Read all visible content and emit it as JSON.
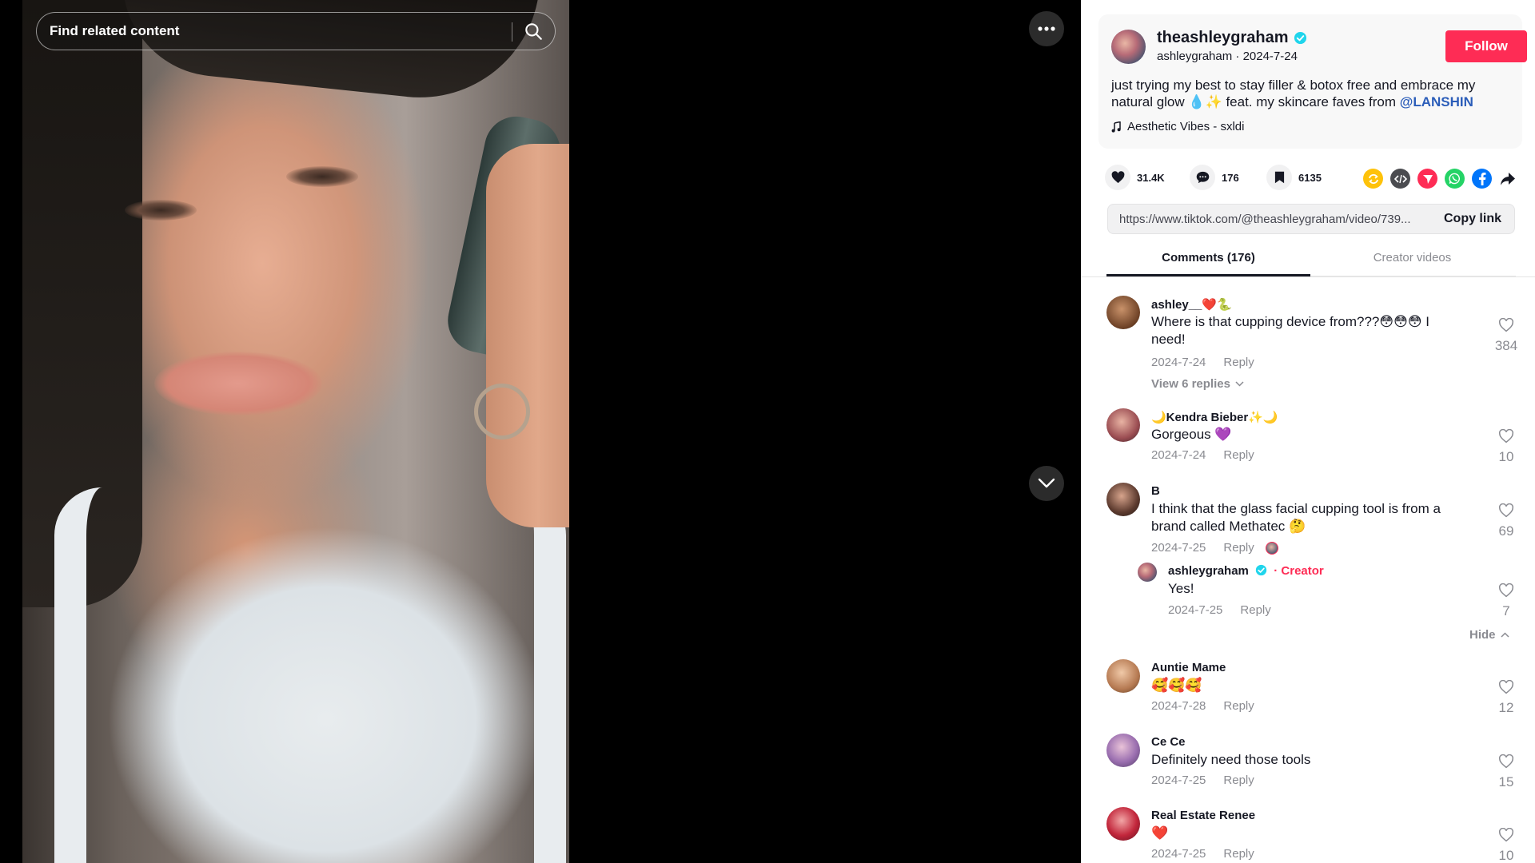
{
  "search": {
    "placeholder": "Find related content"
  },
  "author": {
    "username": "theashleygraham",
    "display": "ashleygraham",
    "date": "2024-7-24",
    "follow_label": "Follow",
    "caption_text": "just trying my best to stay filler & botox free and embrace my natural glow 💧✨ feat. my skincare faves from ",
    "mention": "@LANSHIN",
    "music": "Aesthetic Vibes - sxldi"
  },
  "actions": {
    "likes": "31.4K",
    "comments": "176",
    "saves": "6135"
  },
  "share_icons": [
    "repost-icon",
    "embed-icon",
    "send-icon",
    "whatsapp-icon",
    "facebook-icon",
    "share-arrow-icon"
  ],
  "link": {
    "url": "https://www.tiktok.com/@theashleygraham/video/739...",
    "copy_label": "Copy link"
  },
  "tabs": {
    "comments": "Comments (176)",
    "creator": "Creator videos"
  },
  "comments": [
    {
      "user": "ashley__❤️🐍",
      "text": "Where is that cupping device from???😳😳😳 I need!",
      "date": "2024-7-24",
      "reply": "Reply",
      "likes": "384",
      "view_replies": "View 6 replies"
    },
    {
      "user": "🌙Kendra Bieber✨🌙",
      "text": "Gorgeous 💜",
      "date": "2024-7-24",
      "reply": "Reply",
      "likes": "10"
    },
    {
      "user": "B",
      "text": "I think that the glass facial cupping tool is from a brand called Methatec 🤔",
      "date": "2024-7-25",
      "reply": "Reply",
      "likes": "69"
    },
    {
      "user": "ashleygraham",
      "creator_tag": "· Creator",
      "text": "Yes!",
      "date": "2024-7-25",
      "reply": "Reply",
      "likes": "7"
    },
    {
      "user": "Auntie Mame",
      "text": "🥰🥰🥰",
      "date": "2024-7-28",
      "reply": "Reply",
      "likes": "12"
    },
    {
      "user": "Ce Ce",
      "text": "Definitely need those tools",
      "date": "2024-7-25",
      "reply": "Reply",
      "likes": "15"
    },
    {
      "user": "Real Estate Renee",
      "text": "❤️",
      "date": "2024-7-25",
      "reply": "Reply",
      "likes": "10"
    }
  ],
  "hide_label": "Hide",
  "colors": {
    "follow": "#fe2c55",
    "mention": "#2b5db9",
    "creator": "#fe2c55"
  }
}
